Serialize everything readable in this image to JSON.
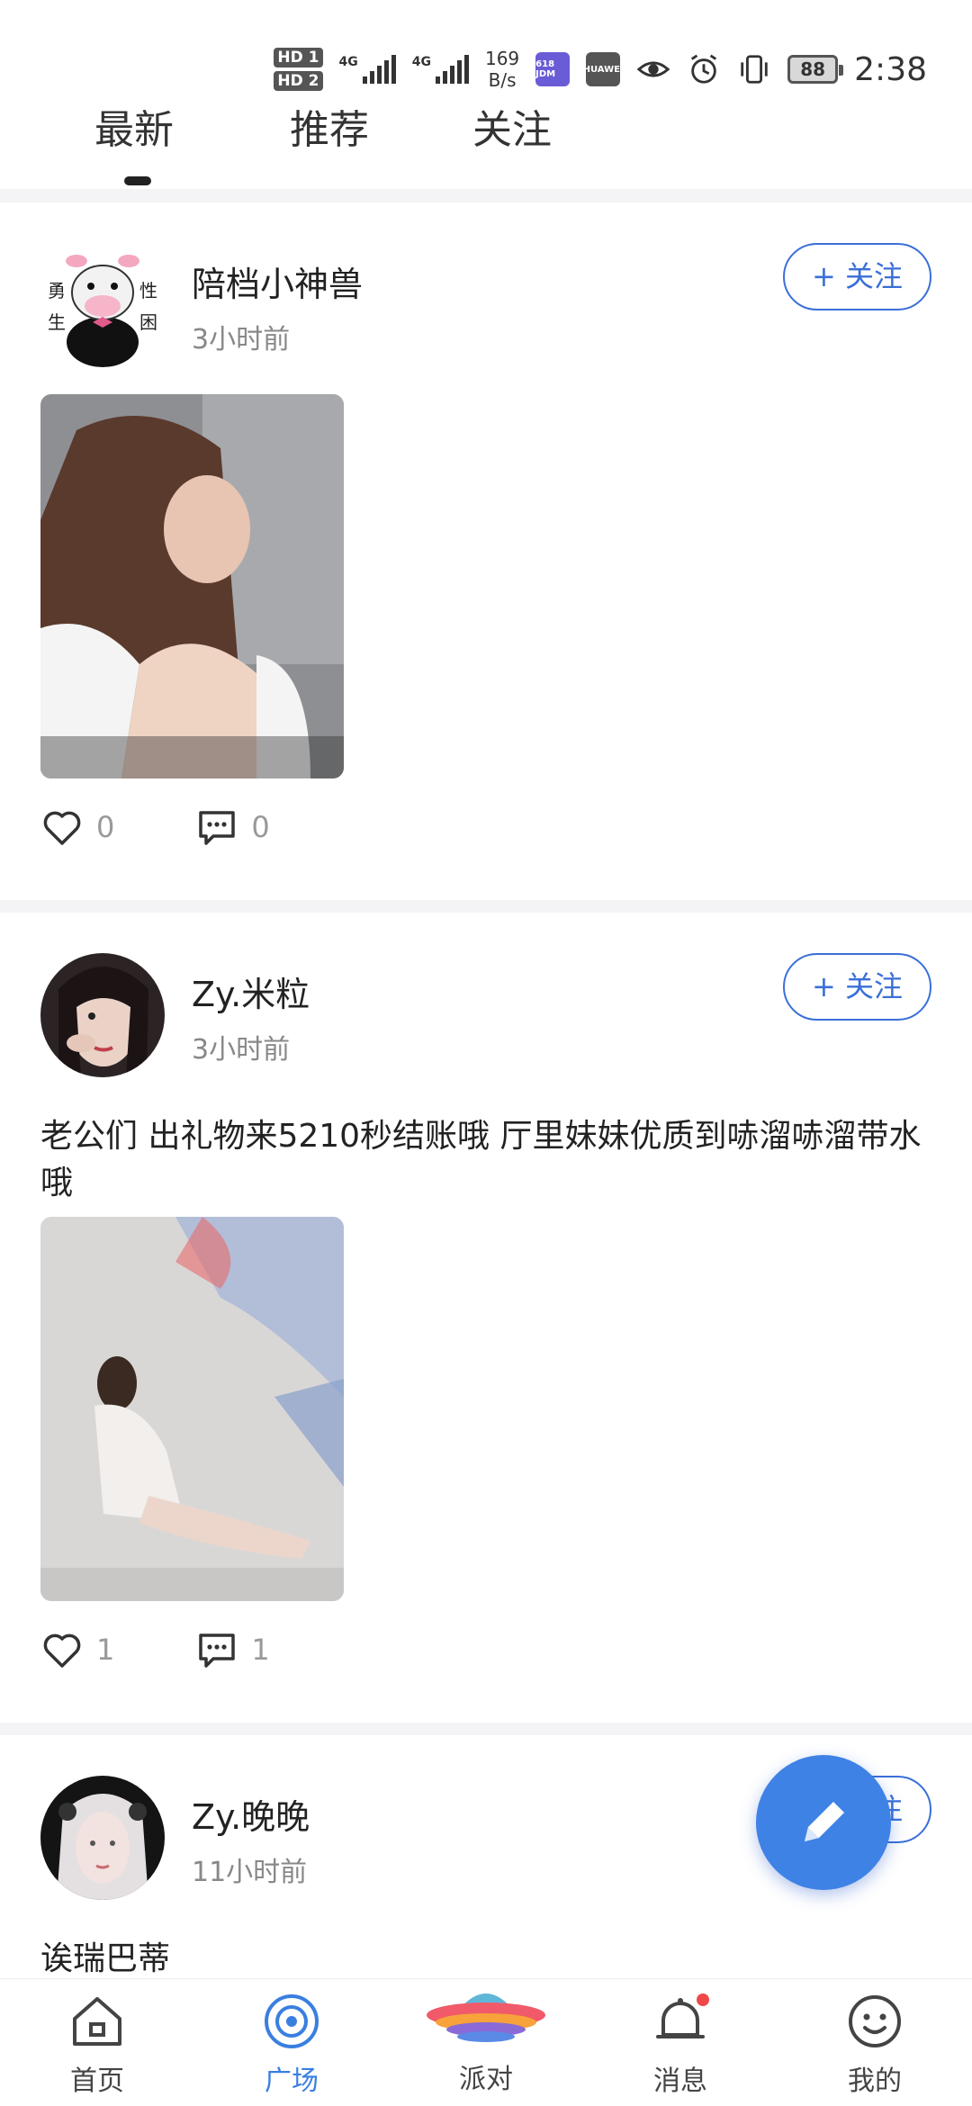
{
  "status_bar": {
    "hd1": "HD 1",
    "hd2": "HD 2",
    "net1": "4G",
    "net2": "4G",
    "speed_value": "169",
    "speed_unit": "B/s",
    "app_jd": "618 JDM",
    "app_hw": "HUAWEI",
    "battery": "88",
    "time": "2:38"
  },
  "tabs": [
    {
      "label": "最新",
      "active": true
    },
    {
      "label": "推荐",
      "active": false
    },
    {
      "label": "关注",
      "active": false
    }
  ],
  "posts": [
    {
      "username": "陪档小神兽",
      "time": "3小时前",
      "follow_label": "+ 关注",
      "text": "",
      "likes": "0",
      "comments": "0"
    },
    {
      "username": "Zy.米粒",
      "time": "3小时前",
      "follow_label": "+ 关注",
      "text": " 老公们 出礼物来5210秒结账哦 厅里妹妹优质到哧溜哧溜带水哦",
      "likes": "1",
      "comments": "1"
    },
    {
      "username": "Zy.晚晚",
      "time": "11小时前",
      "follow_label": "+ 关注",
      "text": "诶瑞巴蒂"
    }
  ],
  "bottom_nav": [
    {
      "label": "首页",
      "icon": "home-icon"
    },
    {
      "label": "广场",
      "icon": "plaza-icon",
      "active": true
    },
    {
      "label": "派对",
      "icon": "party-ufo-icon"
    },
    {
      "label": "消息",
      "icon": "bell-icon",
      "badge": true
    },
    {
      "label": "我的",
      "icon": "smiley-icon"
    }
  ],
  "colors": {
    "accent": "#3a6fd8",
    "fab": "#3f82e6",
    "badge": "#f04848"
  }
}
